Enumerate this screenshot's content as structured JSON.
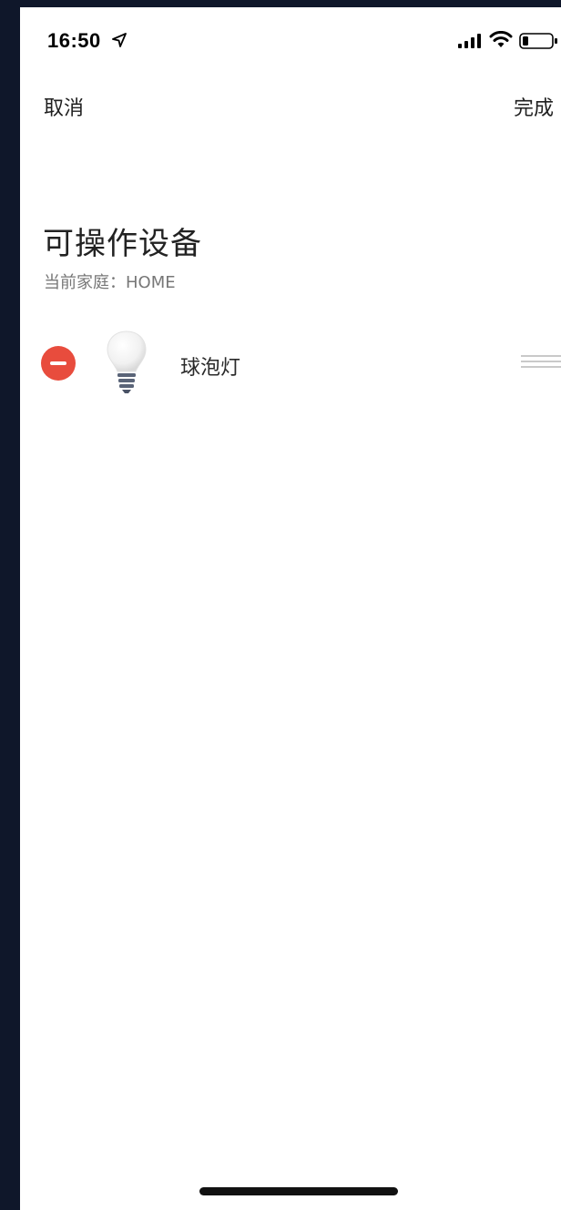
{
  "status_bar": {
    "time": "16:50",
    "icons": [
      "location-arrow-icon",
      "cellular-signal-icon",
      "wifi-icon",
      "battery-icon"
    ]
  },
  "nav": {
    "cancel_label": "取消",
    "done_label": "完成"
  },
  "header": {
    "title": "可操作设备",
    "subtitle": "当前家庭：HOME"
  },
  "devices": [
    {
      "name": "球泡灯",
      "icon": "light-bulb-icon"
    }
  ],
  "colors": {
    "background": "#ffffff",
    "remove_red": "#e84c3d",
    "outer_bg": "#0f172a"
  }
}
